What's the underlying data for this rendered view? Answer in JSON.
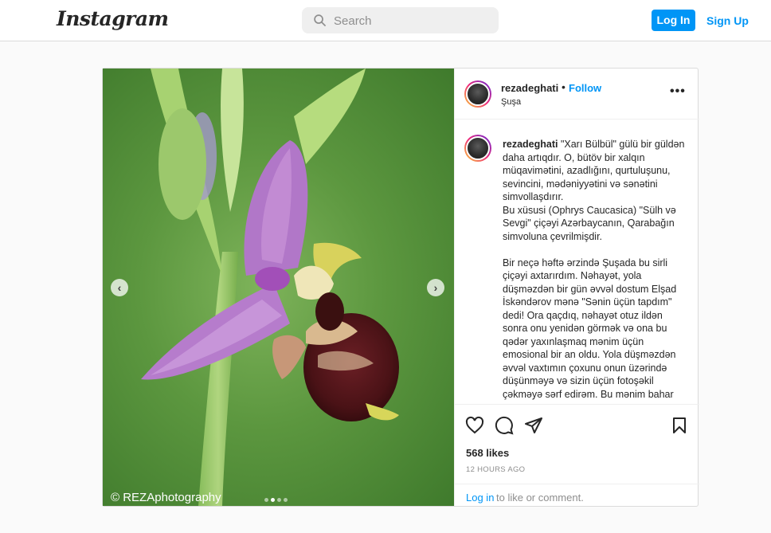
{
  "nav": {
    "logo": "Instagram",
    "search_placeholder": "Search",
    "login_label": "Log In",
    "signup_label": "Sign Up"
  },
  "post": {
    "username": "rezadeghati",
    "separator": "•",
    "follow_label": "Follow",
    "location": "Şuşa",
    "more_label": "•••",
    "watermark": "© REZAphotography",
    "carousel": {
      "total": 4,
      "active_index": 1
    },
    "caption_username": "rezadeghati",
    "caption_body": " \"Xarı Bülbül\" gülü bir güldən daha artıqdır. O, bütöv bir xalqın müqavimətini, azadlığını, qurtuluşunu, sevincini, mədəniyyətini və sənətini simvollaşdırır.\nBu xüsusi (Ophrys Caucasica) \"Sülh və Sevgi\" çiçəyi Azərbaycanın, Qarabağın simvoluna çevrilmişdir.\n\nBir neçə həftə ərzində Şuşada bu sirli çiçəyi axtarırdım. Nəhayət, yola düşməzdən bir gün əvvəl dostum Elşad İskəndərov mənə \"Sənin üçün tapdım\" dedi! Ora qaçdıq, nəhayət otuz ildən sonra onu yenidən görmək və ona bu qədər yaxınlaşmaq mənim üçün emosional bir an oldu. Yola düşməzdən əvvəl vaxtımın çoxunu onun üzərində düşünməyə və sizin üçün fotoşəkil çəkməyə sərf edirəm. Bu mənim bahar",
    "likes": "568 likes",
    "time": "12 HOURS AGO",
    "comment_login": "Log in",
    "comment_rest": "to like or comment."
  },
  "icons": {
    "search": "search-icon",
    "prev": "chevron-left-icon",
    "next": "chevron-right-icon",
    "like": "heart-icon",
    "comment": "comment-icon",
    "share": "send-icon",
    "save": "bookmark-icon"
  },
  "colors": {
    "accent": "#0095f6",
    "text": "#262626",
    "muted": "#8e8e8e",
    "border": "#dbdbdb"
  }
}
